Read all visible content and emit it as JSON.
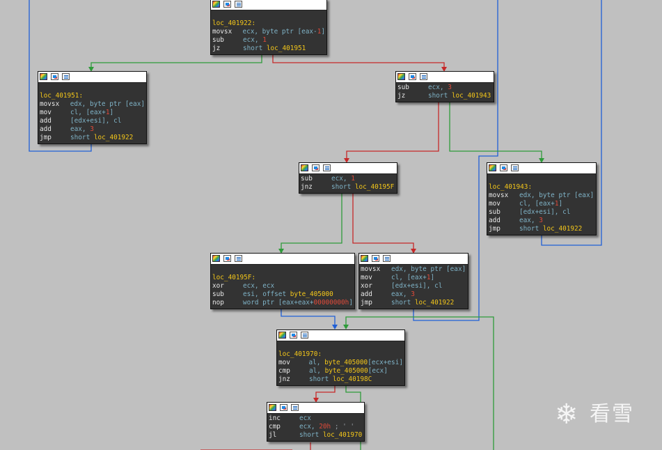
{
  "nodes": [
    {
      "id": "n1",
      "lines": [
        {
          "t": "blank"
        },
        {
          "t": "label",
          "text": "loc_401922:"
        },
        {
          "t": "ins",
          "mn": "movsx",
          "parts": [
            [
              "reg",
              "ecx, byte ptr [eax-"
            ],
            [
              "num",
              "1"
            ],
            [
              "reg",
              "]"
            ]
          ]
        },
        {
          "t": "ins",
          "mn": "sub",
          "parts": [
            [
              "reg",
              "ecx, "
            ],
            [
              "num",
              "1"
            ]
          ]
        },
        {
          "t": "ins",
          "mn": "jz",
          "parts": [
            [
              "reg",
              "short "
            ],
            [
              "sym",
              "loc_401951"
            ]
          ]
        }
      ]
    },
    {
      "id": "n2",
      "lines": [
        {
          "t": "blank"
        },
        {
          "t": "label",
          "text": "loc_401951:"
        },
        {
          "t": "ins",
          "mn": "movsx",
          "parts": [
            [
              "reg",
              "edx, byte ptr [eax]"
            ]
          ]
        },
        {
          "t": "ins",
          "mn": "mov",
          "parts": [
            [
              "reg",
              "cl, [eax+"
            ],
            [
              "num",
              "1"
            ],
            [
              "reg",
              "]"
            ]
          ]
        },
        {
          "t": "ins",
          "mn": "add",
          "parts": [
            [
              "reg",
              "[edx+esi], cl"
            ]
          ]
        },
        {
          "t": "ins",
          "mn": "add",
          "parts": [
            [
              "reg",
              "eax, "
            ],
            [
              "num",
              "3"
            ]
          ]
        },
        {
          "t": "ins",
          "mn": "jmp",
          "parts": [
            [
              "reg",
              "short "
            ],
            [
              "sym",
              "loc_401922"
            ]
          ]
        }
      ]
    },
    {
      "id": "n3",
      "lines": [
        {
          "t": "ins",
          "mn": "sub",
          "parts": [
            [
              "reg",
              "ecx, "
            ],
            [
              "num",
              "3"
            ]
          ]
        },
        {
          "t": "ins",
          "mn": "jz",
          "parts": [
            [
              "reg",
              "short "
            ],
            [
              "sym",
              "loc_401943"
            ]
          ]
        }
      ]
    },
    {
      "id": "n4",
      "lines": [
        {
          "t": "ins",
          "mn": "sub",
          "parts": [
            [
              "reg",
              "ecx, "
            ],
            [
              "num",
              "1"
            ]
          ]
        },
        {
          "t": "ins",
          "mn": "jnz",
          "parts": [
            [
              "reg",
              "short "
            ],
            [
              "sym",
              "loc_40195F"
            ]
          ]
        }
      ]
    },
    {
      "id": "n5",
      "lines": [
        {
          "t": "blank"
        },
        {
          "t": "label",
          "text": "loc_401943:"
        },
        {
          "t": "ins",
          "mn": "movsx",
          "parts": [
            [
              "reg",
              "edx, byte ptr [eax]"
            ]
          ]
        },
        {
          "t": "ins",
          "mn": "mov",
          "parts": [
            [
              "reg",
              "cl, [eax+"
            ],
            [
              "num",
              "1"
            ],
            [
              "reg",
              "]"
            ]
          ]
        },
        {
          "t": "ins",
          "mn": "sub",
          "parts": [
            [
              "reg",
              "[edx+esi], cl"
            ]
          ]
        },
        {
          "t": "ins",
          "mn": "add",
          "parts": [
            [
              "reg",
              "eax, "
            ],
            [
              "num",
              "3"
            ]
          ]
        },
        {
          "t": "ins",
          "mn": "jmp",
          "parts": [
            [
              "reg",
              "short "
            ],
            [
              "sym",
              "loc_401922"
            ]
          ]
        }
      ]
    },
    {
      "id": "n6",
      "lines": [
        {
          "t": "blank"
        },
        {
          "t": "label",
          "text": "loc_40195F:"
        },
        {
          "t": "ins",
          "mn": "xor",
          "parts": [
            [
              "reg",
              "ecx, ecx"
            ]
          ]
        },
        {
          "t": "ins",
          "mn": "sub",
          "parts": [
            [
              "reg",
              "esi, offset "
            ],
            [
              "sym",
              "byte_405000"
            ]
          ]
        },
        {
          "t": "ins",
          "mn": "nop",
          "parts": [
            [
              "reg",
              "word ptr [eax+eax+"
            ],
            [
              "num",
              "00000000h"
            ],
            [
              "reg",
              "]"
            ]
          ]
        }
      ]
    },
    {
      "id": "n7",
      "lines": [
        {
          "t": "ins",
          "mn": "movsx",
          "parts": [
            [
              "reg",
              "edx, byte ptr [eax]"
            ]
          ]
        },
        {
          "t": "ins",
          "mn": "mov",
          "parts": [
            [
              "reg",
              "cl, [eax+"
            ],
            [
              "num",
              "1"
            ],
            [
              "reg",
              "]"
            ]
          ]
        },
        {
          "t": "ins",
          "mn": "xor",
          "parts": [
            [
              "reg",
              "[edx+esi], cl"
            ]
          ]
        },
        {
          "t": "ins",
          "mn": "add",
          "parts": [
            [
              "reg",
              "eax, "
            ],
            [
              "num",
              "3"
            ]
          ]
        },
        {
          "t": "ins",
          "mn": "jmp",
          "parts": [
            [
              "reg",
              "short "
            ],
            [
              "sym",
              "loc_401922"
            ]
          ]
        }
      ]
    },
    {
      "id": "n8",
      "lines": [
        {
          "t": "blank"
        },
        {
          "t": "label",
          "text": "loc_401970:"
        },
        {
          "t": "ins",
          "mn": "mov",
          "parts": [
            [
              "reg",
              "al, "
            ],
            [
              "sym",
              "byte_405000"
            ],
            [
              "reg",
              "[ecx+esi]"
            ]
          ]
        },
        {
          "t": "ins",
          "mn": "cmp",
          "parts": [
            [
              "reg",
              "al, "
            ],
            [
              "sym",
              "byte_405000"
            ],
            [
              "reg",
              "[ecx]"
            ]
          ]
        },
        {
          "t": "ins",
          "mn": "jnz",
          "parts": [
            [
              "reg",
              "short "
            ],
            [
              "sym",
              "loc_40198C"
            ]
          ]
        }
      ]
    },
    {
      "id": "n9",
      "lines": [
        {
          "t": "ins",
          "mn": "inc",
          "parts": [
            [
              "reg",
              "ecx"
            ]
          ]
        },
        {
          "t": "ins",
          "mn": "cmp",
          "parts": [
            [
              "reg",
              "ecx, "
            ],
            [
              "num",
              "20h"
            ],
            [
              "cmt",
              " ; ' '"
            ]
          ]
        },
        {
          "t": "ins",
          "mn": "jl",
          "parts": [
            [
              "reg",
              "short "
            ],
            [
              "sym",
              "loc_401970"
            ]
          ]
        }
      ]
    }
  ],
  "watermark": {
    "glyph": "❄",
    "text": "看雪"
  },
  "colors": {
    "true_edge": "#2e9b3a",
    "false_edge": "#c62828",
    "jump_edge": "#1f5fd6",
    "background": "#c0c0c0",
    "node_bg": "#333333"
  }
}
